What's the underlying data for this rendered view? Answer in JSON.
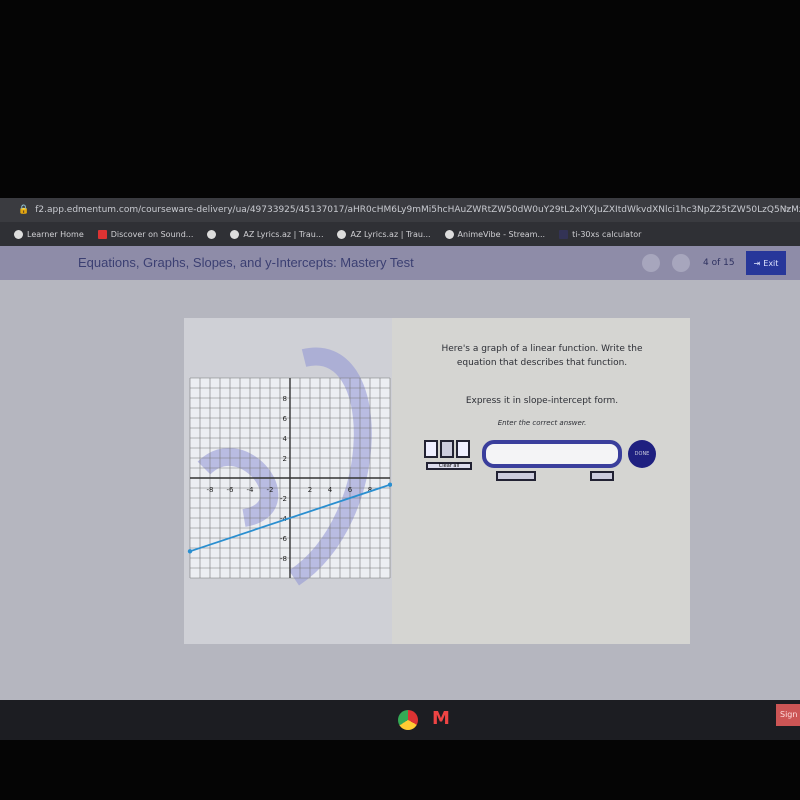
{
  "browser": {
    "url": "f2.app.edmentum.com/courseware-delivery/ua/49733925/45137017/aHR0cHM6Ly9mMi5hcHAuZWRtZW50dW0uY29tL2xlYXJuZXItdWkvdXNlci1hc3NpZ25tZW50LzQ5NzMzOTI1L2x...",
    "bookmarks": [
      {
        "label": "Learner Home"
      },
      {
        "label": "Discover on Sound..."
      },
      {
        "label": ""
      },
      {
        "label": "AZ Lyrics.az | Trau..."
      },
      {
        "label": "AZ Lyrics.az | Trau..."
      },
      {
        "label": "AnimeVibe - Stream..."
      },
      {
        "label": "ti-30xs calculator"
      }
    ]
  },
  "header": {
    "title": "Equations, Graphs, Slopes, and y-Intercepts: Mastery Test",
    "progress": "4 of 15",
    "exit_label": "Exit"
  },
  "question": {
    "prompt": "Here's a graph of a linear function. Write the equation that describes that function.",
    "instruction": "Express it in slope-intercept form.",
    "hint": "Enter the correct answer.",
    "answer_value": "",
    "done_label": "DONE",
    "clear_label": "Clear all"
  },
  "chart_data": {
    "type": "line",
    "xlim": [
      -10,
      10
    ],
    "ylim": [
      -10,
      10
    ],
    "grid": true,
    "x_ticks": [
      -8,
      -6,
      -4,
      -2,
      2,
      4,
      6,
      8
    ],
    "y_ticks": [
      8,
      6,
      4,
      2,
      -2,
      -4,
      -6,
      -8
    ],
    "series": [
      {
        "x": [
          -10,
          10
        ],
        "y": [
          -7.33,
          -0.67
        ],
        "color": "#2a8fd0"
      }
    ]
  },
  "taskbar": {
    "sign_label": "Sign"
  }
}
